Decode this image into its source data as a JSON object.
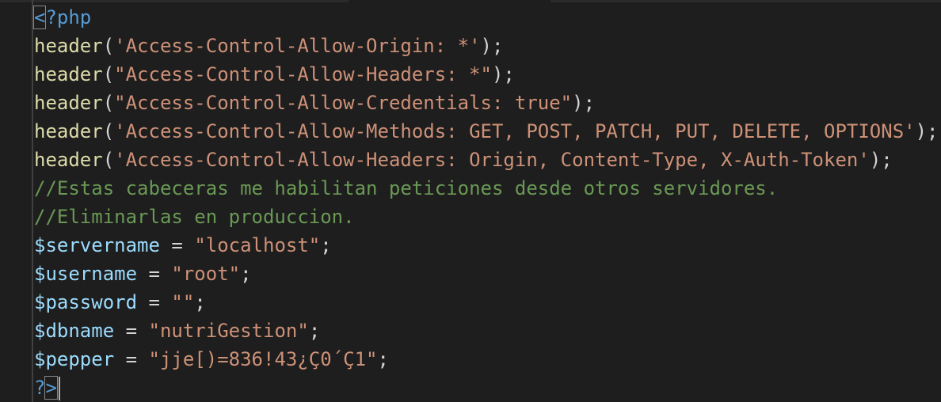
{
  "editor": {
    "language": "php",
    "colors": {
      "background": "#1e1e1e",
      "function": "#dcdcaa",
      "string": "#ce9178",
      "comment": "#6a9955",
      "variable": "#9cdcfe",
      "keyword": "#569cd6",
      "text": "#d4d4d4"
    },
    "lines": [
      {
        "open_tag": "<?php"
      },
      {
        "fn": "header",
        "open": "(",
        "arg": "'Access-Control-Allow-Origin: *'",
        "close": ");"
      },
      {
        "fn": "header",
        "open": "(",
        "arg": "\"Access-Control-Allow-Headers: *\"",
        "close": ");"
      },
      {
        "fn": "header",
        "open": "(",
        "arg": "\"Access-Control-Allow-Credentials: true\"",
        "close": ");"
      },
      {
        "fn": "header",
        "open": "(",
        "arg": "'Access-Control-Allow-Methods: GET, POST, PATCH, PUT, DELETE, OPTIONS'",
        "close": ");"
      },
      {
        "fn": "header",
        "open": "(",
        "arg": "'Access-Control-Allow-Headers: Origin, Content-Type, X-Auth-Token'",
        "close": ");"
      },
      {
        "comment": "//Estas cabeceras me habilitan peticiones desde otros servidores."
      },
      {
        "comment": "//Eliminarlas en produccion."
      },
      {
        "var": "$servername",
        "op": " = ",
        "val": "\"localhost\"",
        "end": ";"
      },
      {
        "var": "$username",
        "op": " = ",
        "val": "\"root\"",
        "end": ";"
      },
      {
        "var": "$password",
        "op": " = ",
        "val": "\"\"",
        "end": ";"
      },
      {
        "var": "$dbname",
        "op": " = ",
        "val": "\"nutriGestion\"",
        "end": ";"
      },
      {
        "var": "$pepper",
        "op": " = ",
        "val": "\"jje[)=836!43¿Ç0´Ç1\"",
        "end": ";"
      },
      {
        "close_tag_q": "?",
        "close_tag_gt": ">"
      }
    ]
  }
}
